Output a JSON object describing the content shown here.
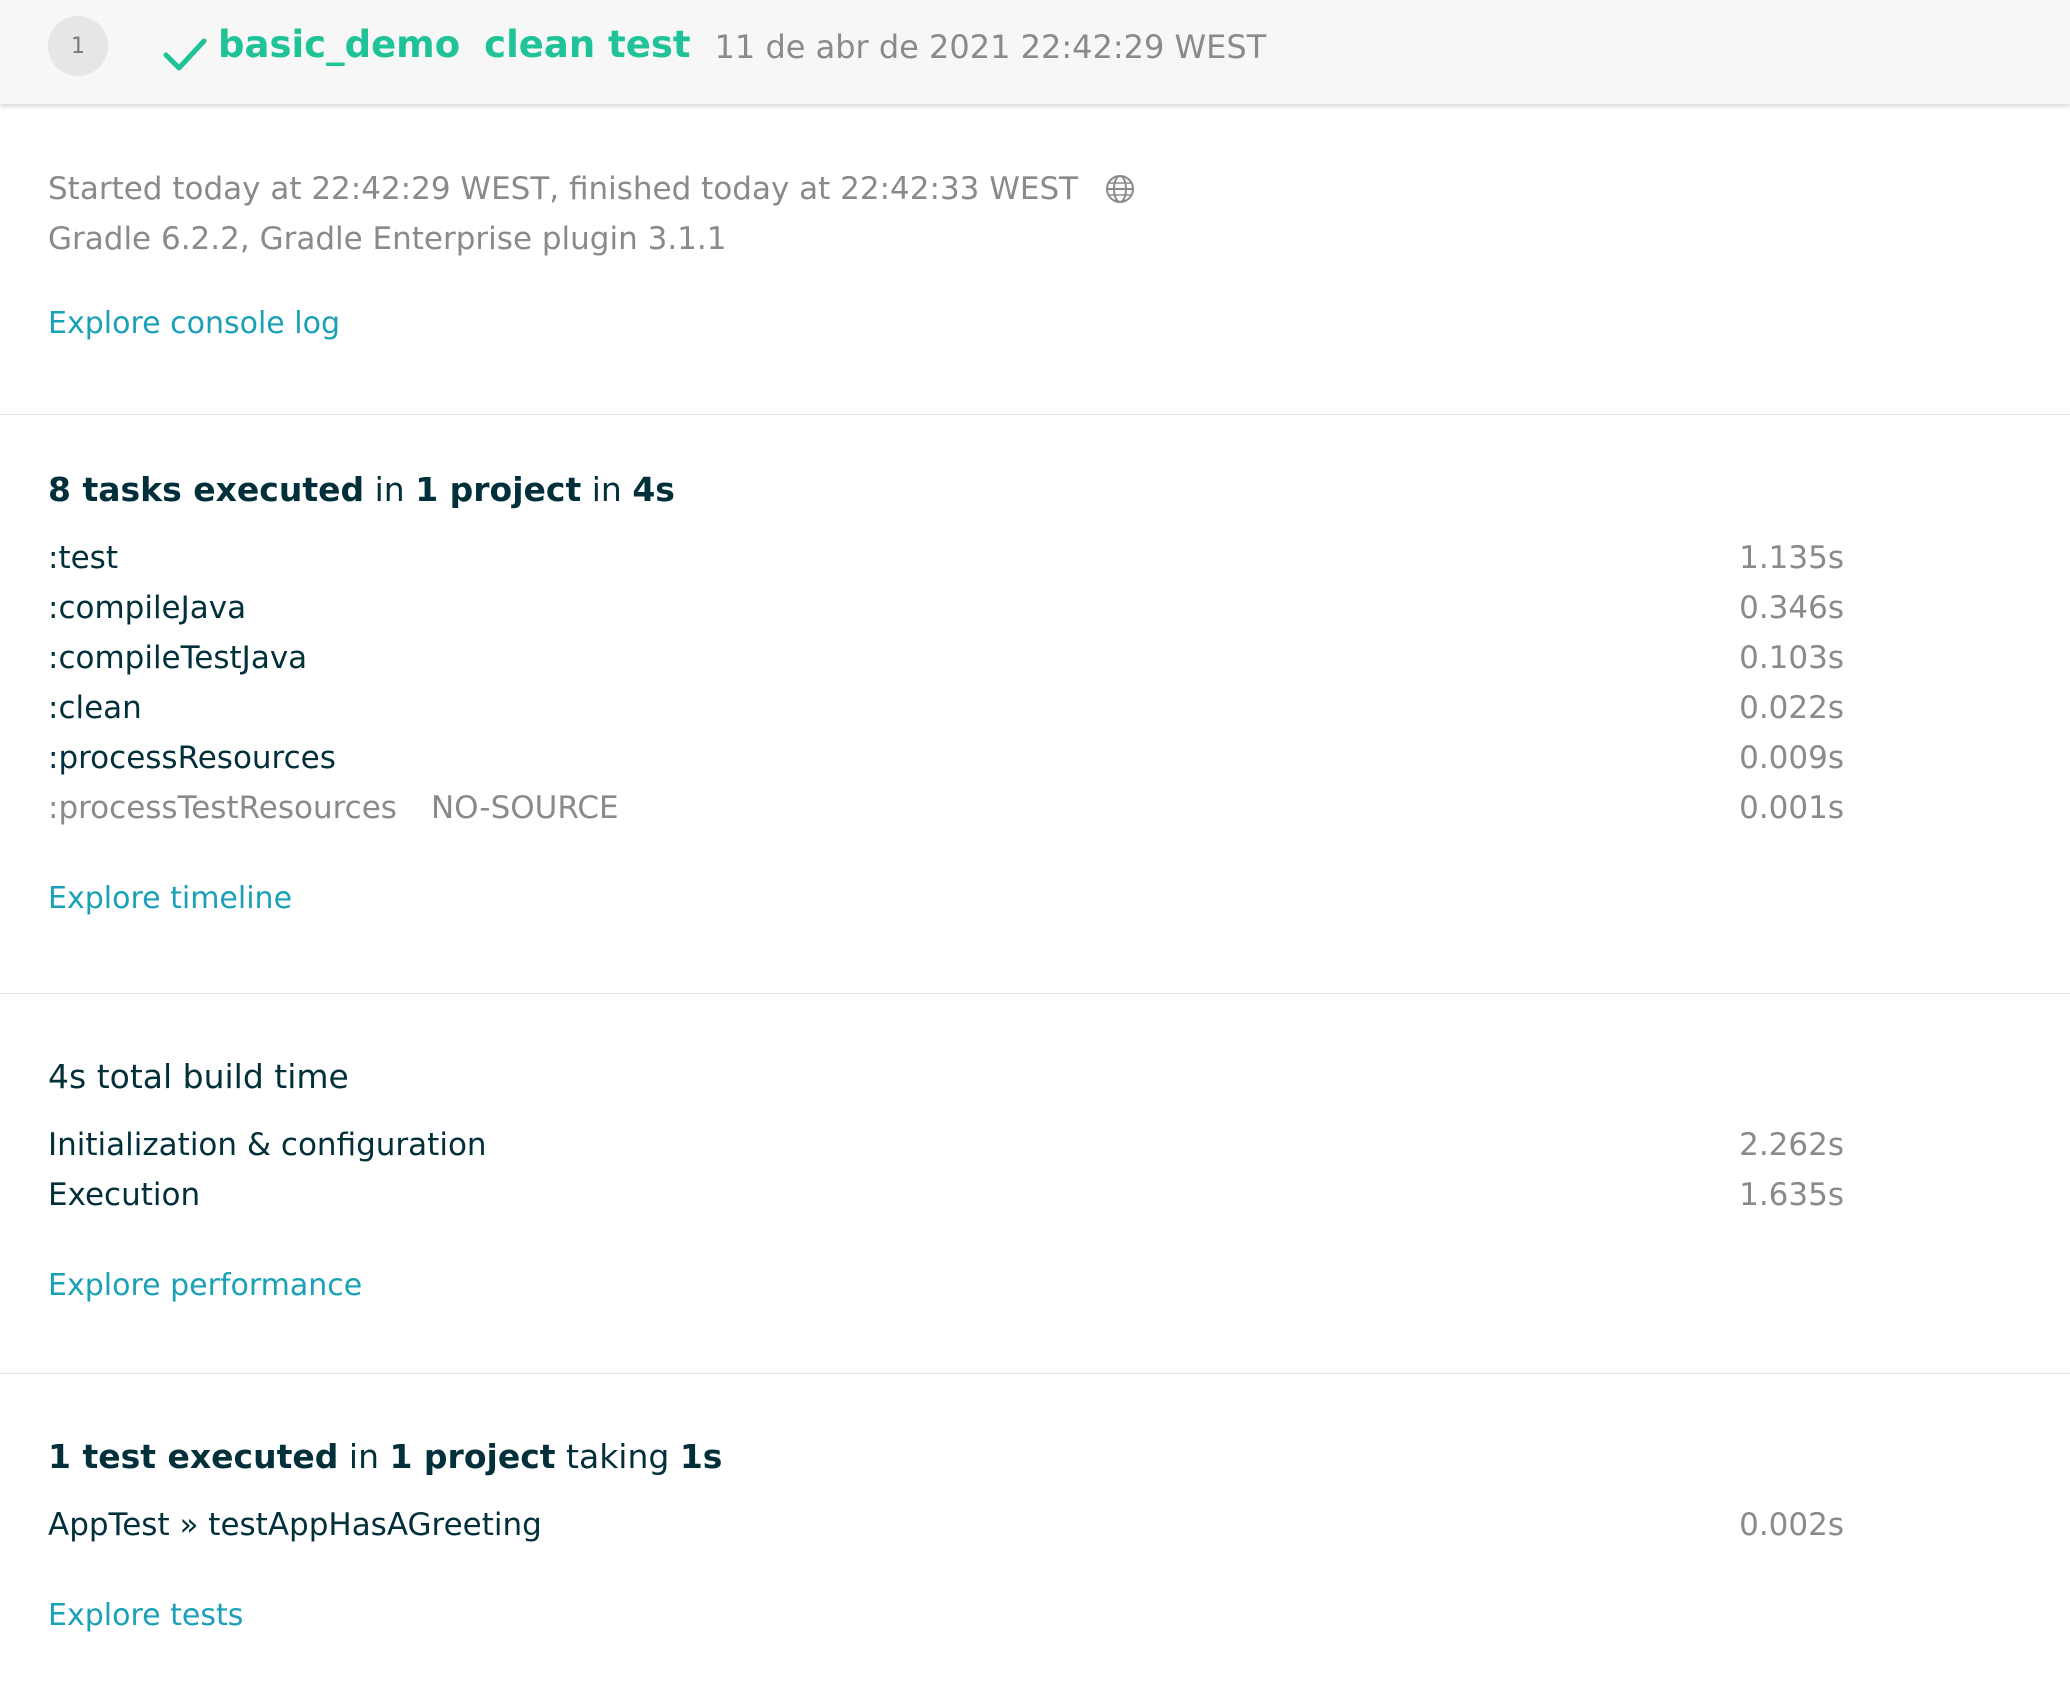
{
  "header": {
    "build_number": "1",
    "project": "basic_demo",
    "requested_tasks": "clean test",
    "date": "11 de abr de 2021 22:42:29 WEST",
    "status_color": "#1fc397"
  },
  "info": {
    "timing": "Started today at 22:42:29 WEST, finished today at 22:42:33 WEST",
    "versions": "Gradle 6.2.2,  Gradle Enterprise plugin 3.1.1",
    "console_link": "Explore console log"
  },
  "tasks": {
    "title_count": "8 tasks executed",
    "title_in1": " in ",
    "title_project": "1 project",
    "title_in2": " in ",
    "title_time": "4s",
    "items": [
      {
        "name": ":test",
        "extra": "",
        "duration": "1.135s"
      },
      {
        "name": ":compileJava",
        "extra": "",
        "duration": "0.346s"
      },
      {
        "name": ":compileTestJava",
        "extra": "",
        "duration": "0.103s"
      },
      {
        "name": ":clean",
        "extra": "",
        "duration": "0.022s"
      },
      {
        "name": ":processResources",
        "extra": "",
        "duration": "0.009s"
      },
      {
        "name": ":processTestResources",
        "extra": "NO-SOURCE",
        "duration": "0.001s"
      }
    ],
    "link": "Explore timeline"
  },
  "performance": {
    "title_time": "4s",
    "title_rest": " total build time",
    "items": [
      {
        "name": "Initialization & configuration",
        "duration": "2.262s"
      },
      {
        "name": "Execution",
        "duration": "1.635s"
      }
    ],
    "link": "Explore performance"
  },
  "tests": {
    "title_count": "1 test executed",
    "title_in": " in ",
    "title_project": "1 project",
    "title_taking": " taking ",
    "title_time": "1s",
    "items": [
      {
        "name": "AppTest » testAppHasAGreeting",
        "duration": "0.002s"
      }
    ],
    "link": "Explore tests"
  },
  "colors": {
    "accent": "#1fc397",
    "link": "#1ba1b7",
    "muted": "#8a8a8a",
    "text": "#02303a"
  }
}
